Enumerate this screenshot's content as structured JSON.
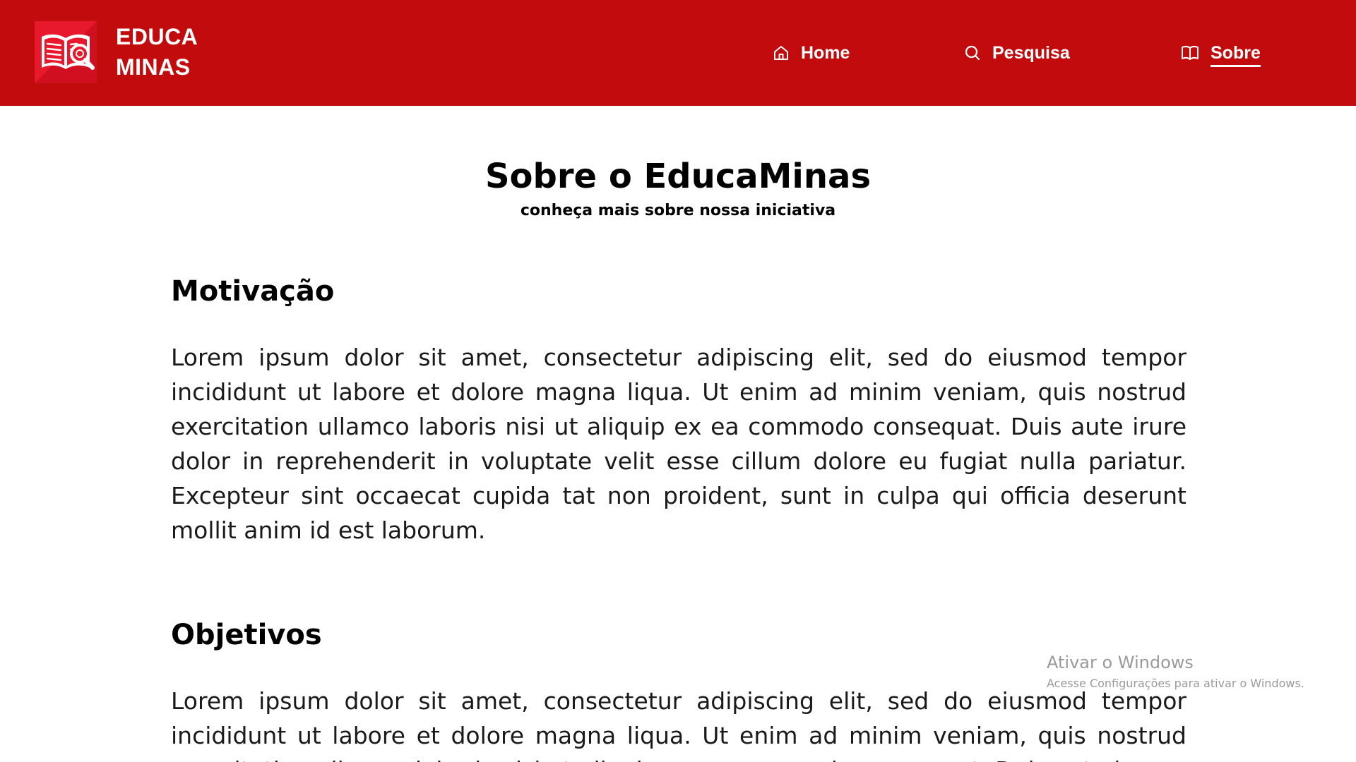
{
  "header": {
    "brand": {
      "logo_icon": "open-book-magnifier-icon",
      "line1": "EDUCA",
      "line2": "MINAS"
    },
    "nav": [
      {
        "label": "Home",
        "icon": "home-icon",
        "active": false
      },
      {
        "label": "Pesquisa",
        "icon": "search-icon",
        "active": false
      },
      {
        "label": "Sobre",
        "icon": "book-icon",
        "active": true
      }
    ],
    "colors": {
      "background": "#c10b0c",
      "text": "#ffffff"
    }
  },
  "main": {
    "title": "Sobre o EducaMinas",
    "subtitle": "conheça mais sobre nossa iniciativa",
    "sections": [
      {
        "heading": "Motivação",
        "body": "Lorem ipsum dolor sit amet, consectetur adipiscing elit, sed do eiusmod tempor incididunt ut labore et dolore magna liqua. Ut enim ad minim veniam, quis nostrud exercitation ullamco laboris nisi ut aliquip ex ea commodo consequat. Duis aute irure dolor in reprehenderit in voluptate velit esse cillum dolore eu fugiat nulla pariatur. Excepteur sint occaecat cupida tat non proident, sunt in culpa qui officia deserunt mollit anim id est laborum."
      },
      {
        "heading": "Objetivos",
        "body": "Lorem ipsum dolor sit amet, consectetur adipiscing elit, sed do eiusmod tempor incididunt ut labore et dolore magna liqua. Ut enim ad minim veniam, quis nostrud exercitation ullamco laboris nisi ut aliquip ex ea commodo consequat. Duis aute irure"
      }
    ]
  },
  "watermark": {
    "title": "Ativar o Windows",
    "subtitle": "Acesse Configurações para ativar o Windows."
  }
}
